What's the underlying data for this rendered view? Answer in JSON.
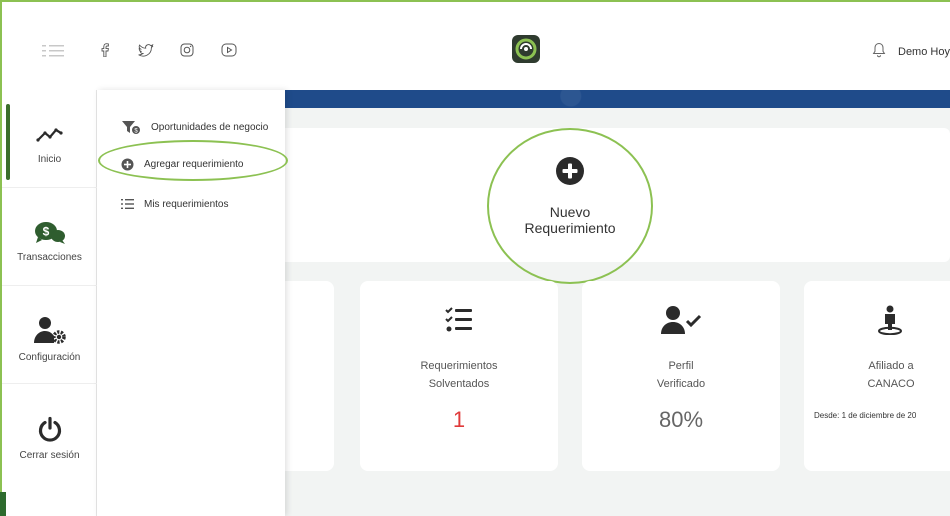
{
  "header": {
    "user_name": "Demo Hoyo",
    "social": [
      "facebook-icon",
      "twitter-icon",
      "instagram-icon",
      "youtube-icon"
    ]
  },
  "sidebar": {
    "items": [
      {
        "label": "Inicio",
        "icon": "trend-line-icon"
      },
      {
        "label": "Transacciones",
        "icon": "money-chat-icon"
      },
      {
        "label": "Configuración",
        "icon": "user-gear-icon"
      },
      {
        "label": "Cerrar sesión",
        "icon": "power-icon"
      }
    ]
  },
  "submenu": {
    "items": [
      {
        "label": "Oportunidades de negocio",
        "icon": "filter-icon"
      },
      {
        "label": "Agregar requerimiento",
        "icon": "plus-circle-icon"
      },
      {
        "label": "Mis requerimientos",
        "icon": "list-icon"
      }
    ]
  },
  "hero": {
    "button_line1": "Nuevo",
    "button_line2": "Requerimiento"
  },
  "stats": [
    {
      "line1": "Requerimientos",
      "line2": "Solventados",
      "value": "1"
    },
    {
      "line1": "Perfil",
      "line2": "Verificado",
      "value": "80%"
    },
    {
      "line1": "Afiliado a",
      "line2": "CANACO",
      "note": "Desde: 1 de diciembre de 20"
    }
  ],
  "colors": {
    "accent": "#8cc152",
    "brand_dark": "#2f3b2f",
    "banner": "#1f4b8a",
    "value_red": "#e03a3a"
  }
}
